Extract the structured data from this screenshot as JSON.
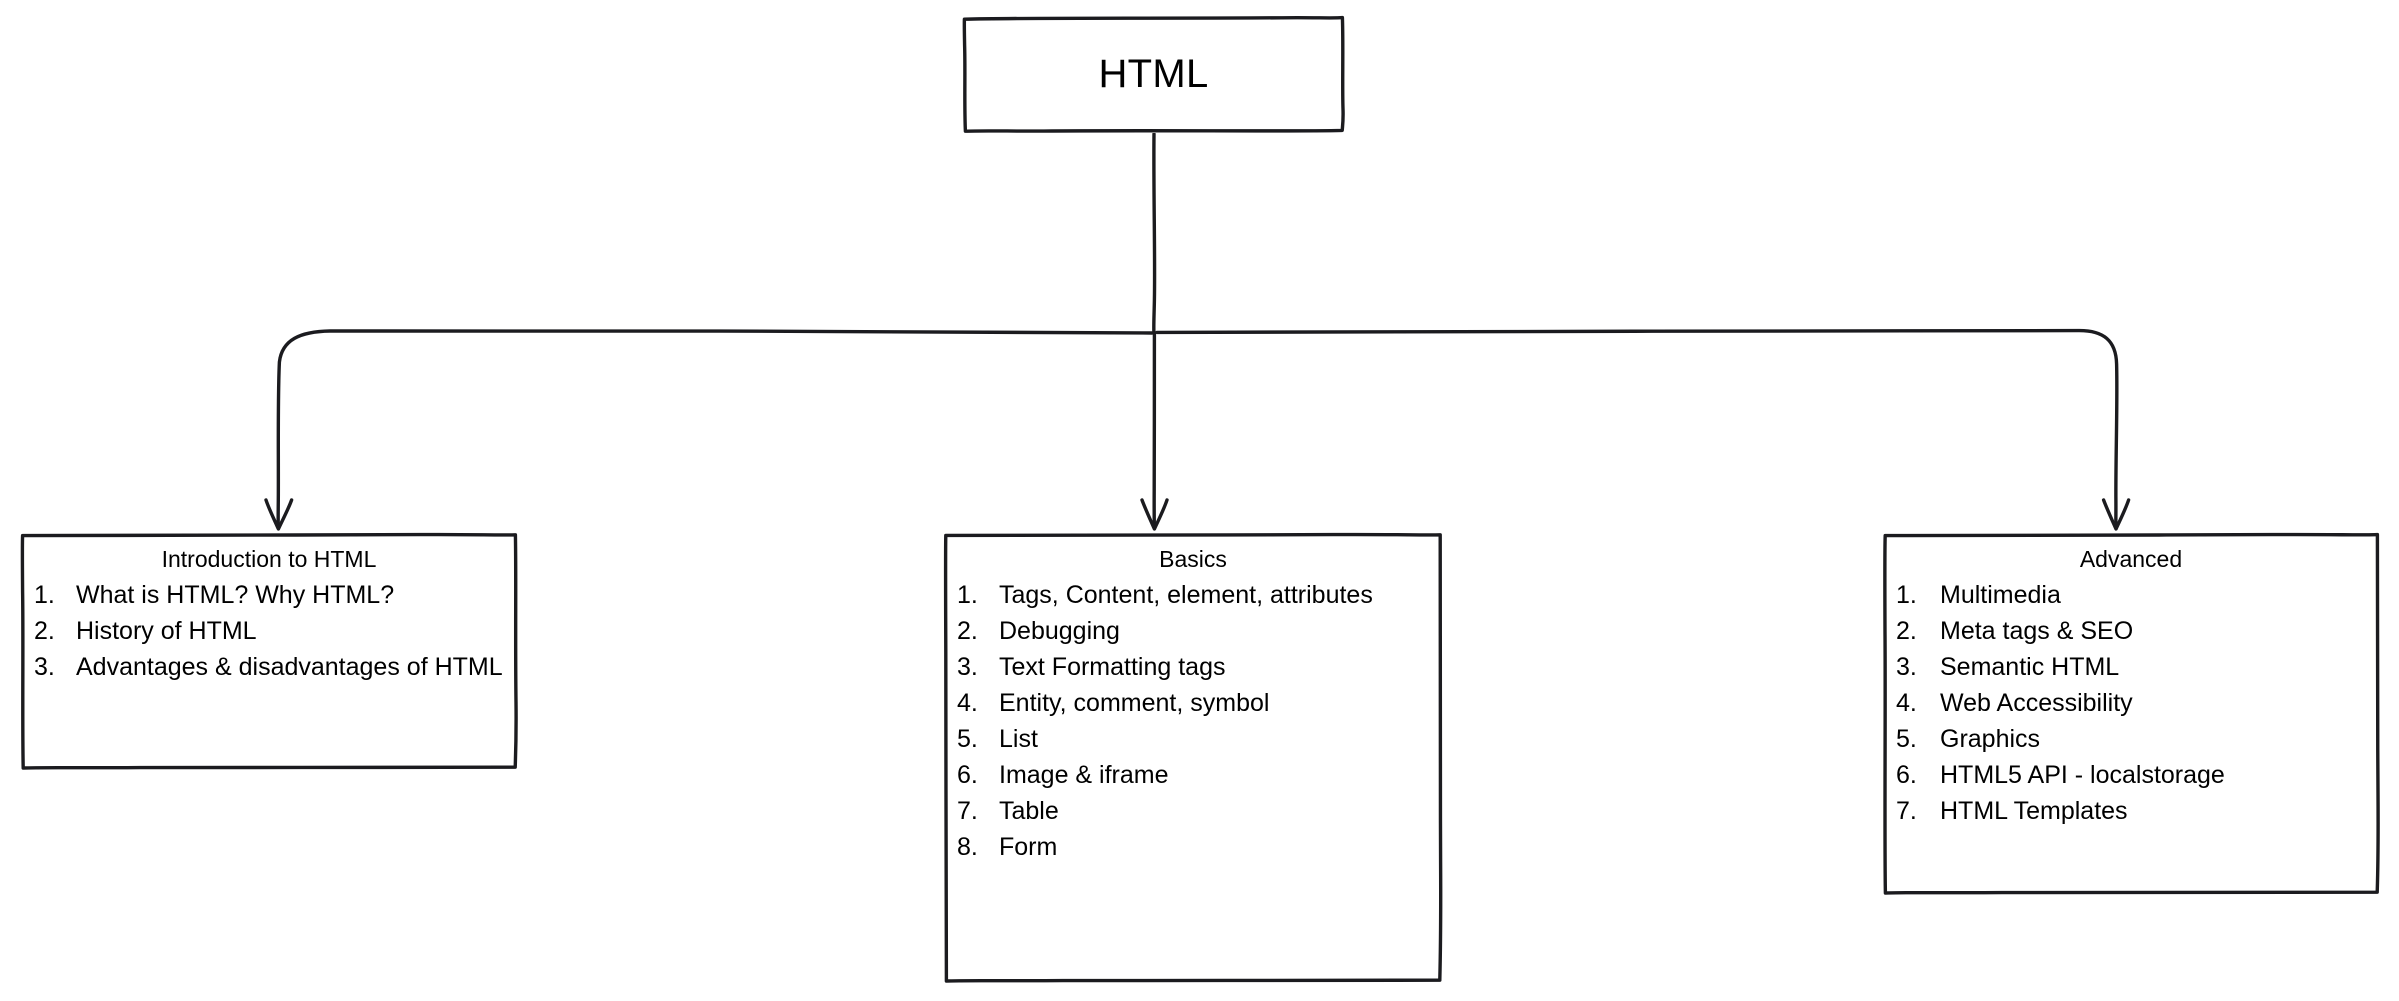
{
  "diagram": {
    "type": "hierarchy-tree",
    "style": "hand-drawn",
    "stroke_color": "#1b1b1f",
    "background_color": "#ffffff",
    "root": {
      "id": "root",
      "title": "HTML"
    },
    "children": [
      {
        "id": "intro",
        "title": "Introduction to HTML",
        "items": [
          {
            "num": "1.",
            "text": "What is HTML? Why HTML?"
          },
          {
            "num": "2.",
            "text": "History of HTML"
          },
          {
            "num": "3.",
            "text": "Advantages & disadvantages of HTML"
          }
        ]
      },
      {
        "id": "basics",
        "title": "Basics",
        "items": [
          {
            "num": "1.",
            "text": "Tags, Content, element, attributes"
          },
          {
            "num": "2.",
            "text": "Debugging"
          },
          {
            "num": "3.",
            "text": "Text Formatting tags"
          },
          {
            "num": "4.",
            "text": "Entity, comment, symbol"
          },
          {
            "num": "5.",
            "text": "List"
          },
          {
            "num": "6.",
            "text": "Image & iframe"
          },
          {
            "num": "7.",
            "text": "Table"
          },
          {
            "num": "8.",
            "text": "Form"
          }
        ]
      },
      {
        "id": "advanced",
        "title": "Advanced",
        "items": [
          {
            "num": "1.",
            "text": "Multimedia"
          },
          {
            "num": "2.",
            "text": "Meta tags & SEO"
          },
          {
            "num": "3.",
            "text": "Semantic HTML"
          },
          {
            "num": "4.",
            "text": "Web Accessibility"
          },
          {
            "num": "5.",
            "text": "Graphics"
          },
          {
            "num": "6.",
            "text": "HTML5 API - localstorage"
          },
          {
            "num": "7.",
            "text": "HTML Templates"
          }
        ]
      }
    ],
    "edges": [
      {
        "from": "root",
        "to": "intro",
        "arrow": "arrow-head-down"
      },
      {
        "from": "root",
        "to": "basics",
        "arrow": "arrow-head-down"
      },
      {
        "from": "root",
        "to": "advanced",
        "arrow": "arrow-head-down"
      }
    ]
  }
}
